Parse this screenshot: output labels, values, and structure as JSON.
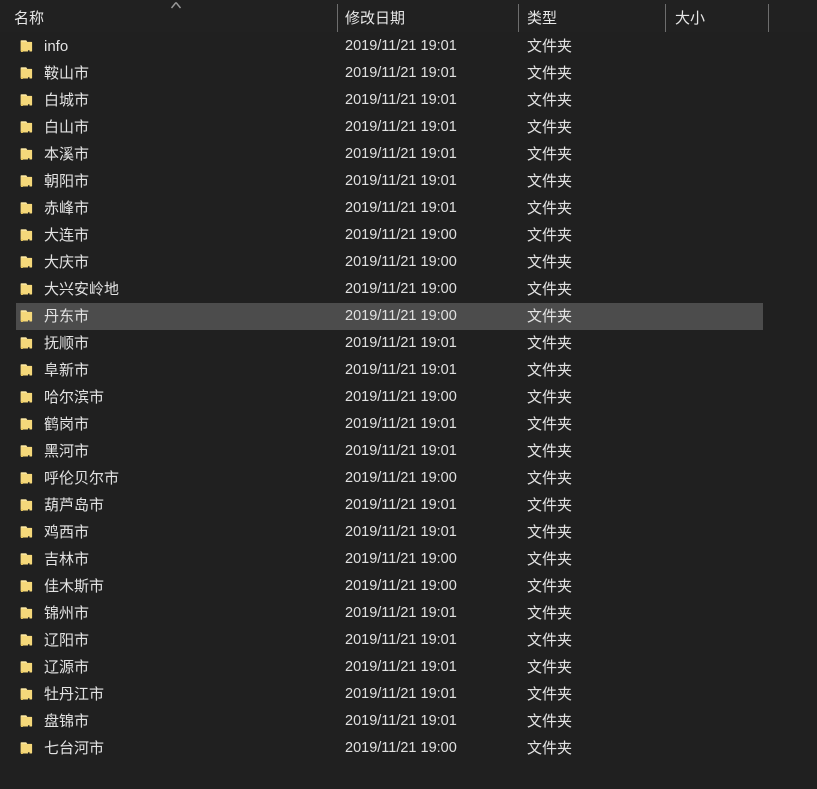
{
  "window": {
    "background_color": "#202020",
    "selection_color": "#4c4c4c",
    "text_color": "#e3e3e3",
    "folder_icon_color": "#f5d77a"
  },
  "columns": [
    {
      "key": "name",
      "label": "名称",
      "sort_indicator": "chevron-up-icon"
    },
    {
      "key": "date",
      "label": "修改日期",
      "sort_indicator": ""
    },
    {
      "key": "type",
      "label": "类型",
      "sort_indicator": ""
    },
    {
      "key": "size",
      "label": "大小",
      "sort_indicator": ""
    }
  ],
  "rows": [
    {
      "icon": "folder-icon",
      "name": "info",
      "date": "2019/11/21 19:01",
      "type": "文件夹",
      "size": "",
      "selected": false
    },
    {
      "icon": "folder-icon",
      "name": "鞍山市",
      "date": "2019/11/21 19:01",
      "type": "文件夹",
      "size": "",
      "selected": false
    },
    {
      "icon": "folder-icon",
      "name": "白城市",
      "date": "2019/11/21 19:01",
      "type": "文件夹",
      "size": "",
      "selected": false
    },
    {
      "icon": "folder-icon",
      "name": "白山市",
      "date": "2019/11/21 19:01",
      "type": "文件夹",
      "size": "",
      "selected": false
    },
    {
      "icon": "folder-icon",
      "name": "本溪市",
      "date": "2019/11/21 19:01",
      "type": "文件夹",
      "size": "",
      "selected": false
    },
    {
      "icon": "folder-icon",
      "name": "朝阳市",
      "date": "2019/11/21 19:01",
      "type": "文件夹",
      "size": "",
      "selected": false
    },
    {
      "icon": "folder-icon",
      "name": "赤峰市",
      "date": "2019/11/21 19:01",
      "type": "文件夹",
      "size": "",
      "selected": false
    },
    {
      "icon": "folder-icon",
      "name": "大连市",
      "date": "2019/11/21 19:00",
      "type": "文件夹",
      "size": "",
      "selected": false
    },
    {
      "icon": "folder-icon",
      "name": "大庆市",
      "date": "2019/11/21 19:00",
      "type": "文件夹",
      "size": "",
      "selected": false
    },
    {
      "icon": "folder-icon",
      "name": "大兴安岭地",
      "date": "2019/11/21 19:00",
      "type": "文件夹",
      "size": "",
      "selected": false
    },
    {
      "icon": "folder-icon",
      "name": "丹东市",
      "date": "2019/11/21 19:00",
      "type": "文件夹",
      "size": "",
      "selected": true
    },
    {
      "icon": "folder-icon",
      "name": "抚顺市",
      "date": "2019/11/21 19:01",
      "type": "文件夹",
      "size": "",
      "selected": false
    },
    {
      "icon": "folder-icon",
      "name": "阜新市",
      "date": "2019/11/21 19:01",
      "type": "文件夹",
      "size": "",
      "selected": false
    },
    {
      "icon": "folder-icon",
      "name": "哈尔滨市",
      "date": "2019/11/21 19:00",
      "type": "文件夹",
      "size": "",
      "selected": false
    },
    {
      "icon": "folder-icon",
      "name": "鹤岗市",
      "date": "2019/11/21 19:01",
      "type": "文件夹",
      "size": "",
      "selected": false
    },
    {
      "icon": "folder-icon",
      "name": "黑河市",
      "date": "2019/11/21 19:01",
      "type": "文件夹",
      "size": "",
      "selected": false
    },
    {
      "icon": "folder-icon",
      "name": "呼伦贝尔市",
      "date": "2019/11/21 19:00",
      "type": "文件夹",
      "size": "",
      "selected": false
    },
    {
      "icon": "folder-icon",
      "name": "葫芦岛市",
      "date": "2019/11/21 19:01",
      "type": "文件夹",
      "size": "",
      "selected": false
    },
    {
      "icon": "folder-icon",
      "name": "鸡西市",
      "date": "2019/11/21 19:01",
      "type": "文件夹",
      "size": "",
      "selected": false
    },
    {
      "icon": "folder-icon",
      "name": "吉林市",
      "date": "2019/11/21 19:00",
      "type": "文件夹",
      "size": "",
      "selected": false
    },
    {
      "icon": "folder-icon",
      "name": "佳木斯市",
      "date": "2019/11/21 19:00",
      "type": "文件夹",
      "size": "",
      "selected": false
    },
    {
      "icon": "folder-icon",
      "name": "锦州市",
      "date": "2019/11/21 19:01",
      "type": "文件夹",
      "size": "",
      "selected": false
    },
    {
      "icon": "folder-icon",
      "name": "辽阳市",
      "date": "2019/11/21 19:01",
      "type": "文件夹",
      "size": "",
      "selected": false
    },
    {
      "icon": "folder-icon",
      "name": "辽源市",
      "date": "2019/11/21 19:01",
      "type": "文件夹",
      "size": "",
      "selected": false
    },
    {
      "icon": "folder-icon",
      "name": "牡丹江市",
      "date": "2019/11/21 19:01",
      "type": "文件夹",
      "size": "",
      "selected": false
    },
    {
      "icon": "folder-icon",
      "name": "盘锦市",
      "date": "2019/11/21 19:01",
      "type": "文件夹",
      "size": "",
      "selected": false
    },
    {
      "icon": "folder-icon",
      "name": "七台河市",
      "date": "2019/11/21 19:00",
      "type": "文件夹",
      "size": "",
      "selected": false
    },
    {
      "icon": "folder-icon",
      "name": "",
      "date": "",
      "type": "",
      "size": "",
      "selected": false
    }
  ]
}
